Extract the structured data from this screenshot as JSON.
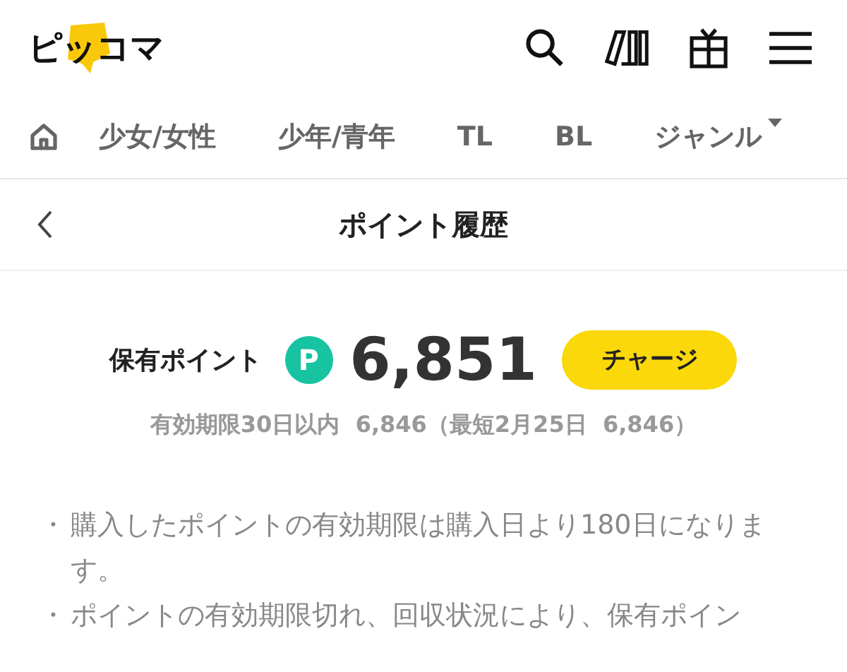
{
  "header": {
    "logo": "ピッコマ"
  },
  "nav": {
    "items": [
      {
        "kind": "home",
        "selected": false
      },
      {
        "kind": "text",
        "label": "少女/女性",
        "selected": false
      },
      {
        "kind": "text",
        "label": "少年/青年",
        "selected": false
      },
      {
        "kind": "text",
        "label": "TL",
        "selected": false
      },
      {
        "kind": "text",
        "label": "BL",
        "selected": false
      },
      {
        "kind": "dropdown",
        "label": "ジャンル",
        "selected": false
      }
    ]
  },
  "title_bar": {
    "title": "ポイント履歴"
  },
  "points": {
    "label": "保有ポイント",
    "badge": "P",
    "amount": "6,851",
    "button": "チャージ"
  },
  "expiry": "有効期限30日以内  6,846（最短2月25日  6,846）",
  "notes": [
    {
      "marker": "・",
      "text": "購入したポイントの有効期限は購入日より180日になります。"
    },
    {
      "marker": "・",
      "text": "ポイントの有効期限切れ、回収状況により、保有ポイン"
    }
  ]
}
